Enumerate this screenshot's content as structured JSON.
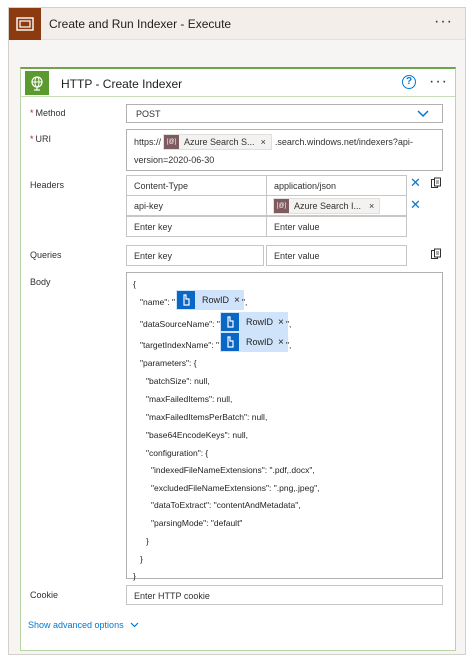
{
  "scope": {
    "title": "Create and Run Indexer - Execute",
    "menu": "···"
  },
  "action": {
    "title": "HTTP - Create Indexer",
    "help": "?",
    "menu": "···"
  },
  "method": {
    "label": "Method",
    "required": "*",
    "value": "POST"
  },
  "uri": {
    "label": "URI",
    "required": "*",
    "prefix": "https://",
    "token": "Azure Search S...",
    "token_close": "×",
    "suffix": ".search.windows.net/indexers?api-",
    "line2": "version=2020-06-30"
  },
  "headers": {
    "label": "Headers",
    "rows": [
      {
        "key": "Content-Type",
        "value": "application/json"
      },
      {
        "key": "api-key",
        "token": "Azure Search I...",
        "token_close": "×"
      }
    ],
    "key_placeholder": "Enter key",
    "value_placeholder": "Enter value"
  },
  "queries": {
    "label": "Queries",
    "key_placeholder": "Enter key",
    "value_placeholder": "Enter value"
  },
  "body": {
    "label": "Body",
    "lines": [
      "{",
      "\"name\": \"",
      "\"dataSourceName\": \"",
      "\"targetIndexName\": \"",
      "\"parameters\": {",
      "\"batchSize\": null,",
      "\"maxFailedItems\": null,",
      "\"maxFailedItemsPerBatch\": null,",
      "\"base64EncodeKeys\": null,",
      "\"configuration\": {",
      "\"indexedFileNameExtensions\": \".pdf,.docx\",",
      "\"excludedFileNameExtensions\": \".png,.jpeg\",",
      "\"dataToExtract\": \"contentAndMetadata\",",
      "\"parsingMode\": \"default\"",
      "}",
      "}",
      "}"
    ],
    "token": "RowID",
    "token_close": "×",
    "after_name": "\",",
    "after_ds": "\",",
    "after_ti": "\","
  },
  "cookie": {
    "label": "Cookie",
    "placeholder": "Enter HTTP cookie"
  },
  "advanced": {
    "label": "Show advanced options"
  },
  "colors": {
    "scope_icon": "#8c3b11",
    "http_icon": "#5b9a2e",
    "accent": "#0078d4",
    "token_blue": "#cfe4fa"
  }
}
